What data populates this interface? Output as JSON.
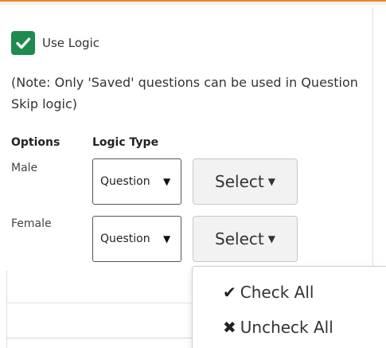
{
  "use_logic": {
    "label": "Use Logic",
    "checked": true,
    "check_color": "#1e8a4e"
  },
  "note": "(Note: Only 'Saved' questions can be used in Question Skip logic)",
  "headers": {
    "options": "Options",
    "logic_type": "Logic Type"
  },
  "rows": [
    {
      "option": "Male",
      "logic_type_value": "Question",
      "select_label": "Select"
    },
    {
      "option": "Female",
      "logic_type_value": "Question",
      "select_label": "Select"
    }
  ],
  "dropdown": {
    "check_all": "Check All",
    "uncheck_all": "Uncheck All"
  },
  "colors": {
    "accent_top": "#e8891c"
  }
}
